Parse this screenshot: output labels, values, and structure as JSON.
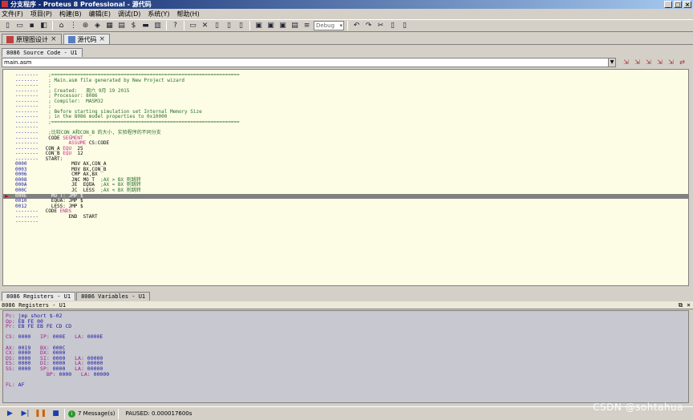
{
  "window": {
    "title": "分支程序 - Proteus 8 Professional - 源代码",
    "controls": [
      "_",
      "□",
      "×"
    ]
  },
  "menu": [
    "文件(F)",
    "项目(P)",
    "构建(B)",
    "编辑(E)",
    "调试(D)",
    "系统(Y)",
    "帮助(H)"
  ],
  "toolbar": {
    "debug_combo": "Debug"
  },
  "doc_tabs": [
    {
      "label": "原理图设计",
      "close": "×",
      "active": false
    },
    {
      "label": "源代码",
      "close": "×",
      "active": true
    }
  ],
  "source_panel": {
    "tab": "8086 Source Code - U1",
    "file": "main.asm"
  },
  "code_lines": [
    {
      "addr": "--------",
      "text": "  ;=================================================================",
      "type": "cmt"
    },
    {
      "addr": "--------",
      "text": "  ; Main.asm file generated by New Project wizard",
      "type": "cmt"
    },
    {
      "addr": "--------",
      "text": "  ;",
      "type": "cmt"
    },
    {
      "addr": "--------",
      "text": "  ; Created:   周六 9月 19 2015",
      "type": "cmt"
    },
    {
      "addr": "--------",
      "text": "  ; Processor: 8086",
      "type": "cmt"
    },
    {
      "addr": "--------",
      "text": "  ; Compiler:  MASM32",
      "type": "cmt"
    },
    {
      "addr": "--------",
      "text": "  ;",
      "type": "cmt"
    },
    {
      "addr": "--------",
      "text": "  ; Before starting simulation set Internal Memory Size",
      "type": "cmt"
    },
    {
      "addr": "--------",
      "text": "  ; in the 8086 model properties to 0x10000",
      "type": "cmt"
    },
    {
      "addr": "--------",
      "text": "  ;=================================================================",
      "type": "cmt"
    },
    {
      "addr": "--------",
      "text": "",
      "type": "plain"
    },
    {
      "addr": "--------",
      "text": "  ;比较CON_A和CON_B 的大小, 实验程序的不同分支",
      "type": "cmt"
    },
    {
      "addr": "--------",
      "pre": "  CODE ",
      "kw": "SEGMENT",
      "post": "",
      "type": "kw"
    },
    {
      "addr": "--------",
      "pre": "         ",
      "kw": "ASSUME",
      "post": " CS:CODE",
      "type": "kw"
    },
    {
      "addr": "--------",
      "pre": " CON_A ",
      "kw": "EQU",
      "post": "  25",
      "type": "kw"
    },
    {
      "addr": "--------",
      "pre": " CON_B ",
      "kw": "EQU",
      "post": "  12",
      "type": "kw"
    },
    {
      "addr": "--------",
      "text": " START:",
      "type": "plain"
    },
    {
      "addr": "0000",
      "text": "          MOV AX,CON_A",
      "type": "plain"
    },
    {
      "addr": "0003",
      "text": "          MOV BX,CON_B",
      "type": "plain"
    },
    {
      "addr": "0006",
      "text": "          CMP AX,BX",
      "type": "plain"
    },
    {
      "addr": "0008",
      "text": "          JNC MO_T",
      "cmt": "  ;AX > BX 则跳转",
      "type": "mixed"
    },
    {
      "addr": "000A",
      "text": "          JE  EQUA",
      "cmt": "  ;AX = BX 则跳转",
      "type": "mixed"
    },
    {
      "addr": "000C",
      "text": "          JC  LESS",
      "cmt": "  ;AX < BX 则跳转",
      "type": "mixed"
    },
    {
      "addr": "000E",
      "text": "   MO_T: JMP $",
      "type": "current"
    },
    {
      "addr": "0010",
      "text": "   EQUA: JMP $",
      "type": "plain"
    },
    {
      "addr": "0012",
      "text": "   LESS: JMP $",
      "type": "plain"
    },
    {
      "addr": "--------",
      "pre": " CODE ",
      "kw": "ENDS",
      "post": "",
      "type": "kw"
    },
    {
      "addr": "--------",
      "text": "         END  START",
      "type": "plain"
    },
    {
      "addr": "--------",
      "text": "",
      "type": "plain"
    }
  ],
  "bottom_tabs": [
    {
      "label": "8086 Registers - U1",
      "active": true
    },
    {
      "label": "8086 Variables - U1",
      "active": false
    }
  ],
  "registers_panel": {
    "title": "8086 Registers - U1",
    "pc": "jmp short $-02",
    "op": "EB FE 00",
    "pr": "EB FE EB FE CD CD",
    "cs": "0000",
    "ip": "000E",
    "la": "0000E",
    "ax": "0019",
    "bx": "000C",
    "cx": "0000",
    "dx": "0000",
    "ds": "0000",
    "si": "0000",
    "ds_la": "00000",
    "es": "0000",
    "di": "0000",
    "es_la": "00000",
    "ss": "0000",
    "sp": "0000",
    "ss_la": "00000",
    "bp": "0000",
    "bp_la": "00000",
    "fl": "AF"
  },
  "status": {
    "messages": "7 Message(s)",
    "paused": "PAUSED: 0.000017600s"
  },
  "watermark": "CSDN @sohtahua"
}
